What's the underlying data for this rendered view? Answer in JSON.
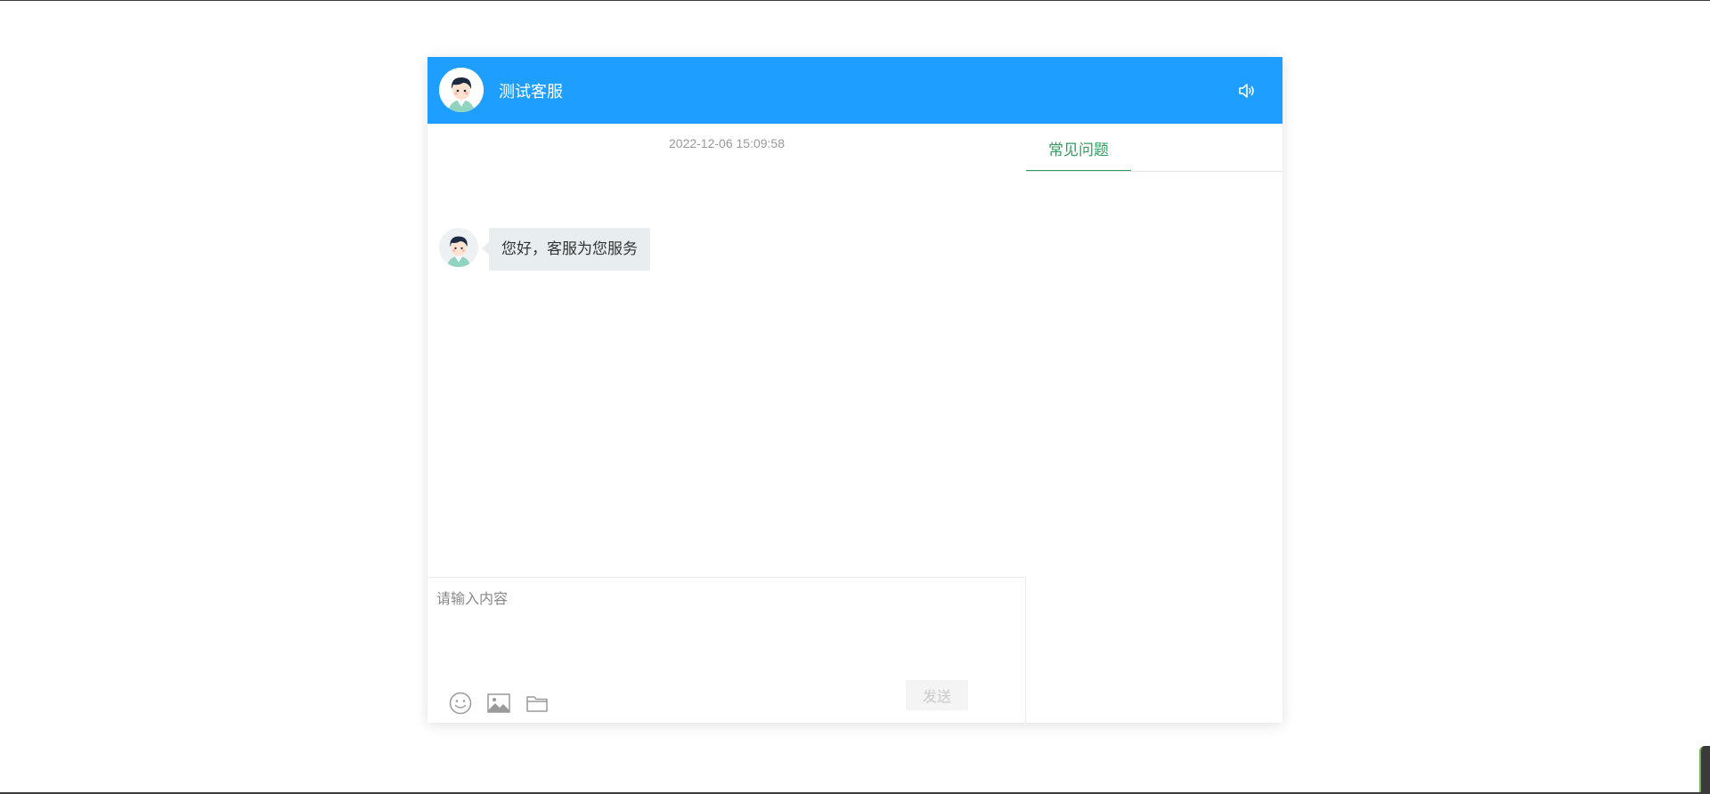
{
  "header": {
    "title": "测试客服",
    "avatar_icon": "agent-avatar-icon",
    "sound_icon": "speaker-icon"
  },
  "chat": {
    "timestamp": "2022-12-06 15:09:58",
    "messages": [
      {
        "sender": "agent",
        "text": "您好，客服为您服务"
      }
    ]
  },
  "composer": {
    "placeholder": "请输入内容",
    "tools": [
      "emoji-icon",
      "image-icon",
      "folder-icon"
    ],
    "send_label": "发送"
  },
  "faq": {
    "tabs": [
      {
        "label": "常见问题",
        "active": true
      }
    ]
  },
  "colors": {
    "header_bg": "#1e9fff",
    "accent_green": "#2e9e61",
    "bubble_bg": "#e8eef0"
  }
}
